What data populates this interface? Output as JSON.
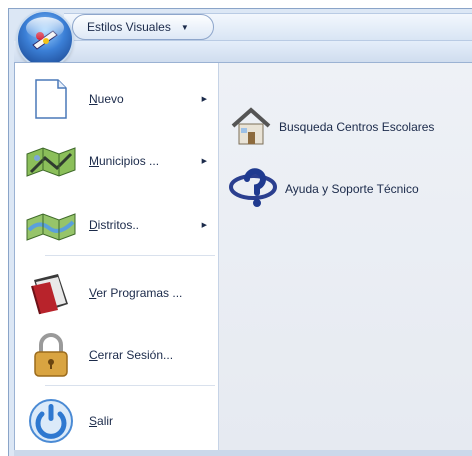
{
  "quick_access": {
    "styles_label": "Estilos Visuales"
  },
  "menu": {
    "left_items": [
      {
        "label": "Nuevo",
        "has_submenu": true,
        "icon": "new-document-icon"
      },
      {
        "label": "Municipios ...",
        "has_submenu": true,
        "icon": "map-icon"
      },
      {
        "label": "Distritos..",
        "has_submenu": true,
        "icon": "map-icon"
      },
      {
        "label": "Ver Programas ...",
        "has_submenu": false,
        "icon": "books-icon"
      },
      {
        "label": "Cerrar Sesión...",
        "has_submenu": false,
        "icon": "padlock-icon"
      },
      {
        "label": "Salir",
        "has_submenu": false,
        "icon": "power-icon"
      }
    ],
    "right_items": [
      {
        "label": "Busqueda Centros Escolares",
        "icon": "house-icon"
      },
      {
        "label": "Ayuda y Soporte Técnico",
        "icon": "help-icon"
      }
    ]
  },
  "colors": {
    "accent": "#3b7fd6",
    "frame": "#dce7f5"
  }
}
